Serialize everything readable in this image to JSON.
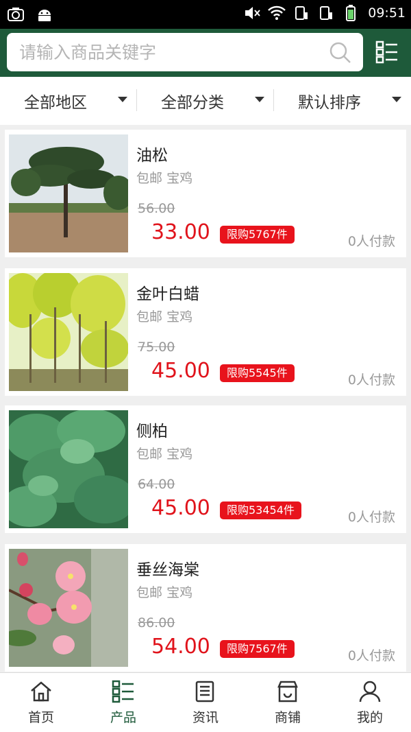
{
  "status_bar": {
    "time": "09:51"
  },
  "search": {
    "placeholder": "请输入商品关键字"
  },
  "filters": [
    {
      "label": "全部地区"
    },
    {
      "label": "全部分类"
    },
    {
      "label": "默认排序"
    }
  ],
  "products": [
    {
      "name": "油松",
      "shipping": "包邮",
      "city": "宝鸡",
      "original_price": "56.00",
      "price": "33.00",
      "limit": "限购5767件",
      "buyers": "0人付款"
    },
    {
      "name": "金叶白蜡",
      "shipping": "包邮",
      "city": "宝鸡",
      "original_price": "75.00",
      "price": "45.00",
      "limit": "限购5545件",
      "buyers": "0人付款"
    },
    {
      "name": "侧柏",
      "shipping": "包邮",
      "city": "宝鸡",
      "original_price": "64.00",
      "price": "45.00",
      "limit": "限购53454件",
      "buyers": "0人付款"
    },
    {
      "name": "垂丝海棠",
      "shipping": "包邮",
      "city": "宝鸡",
      "original_price": "86.00",
      "price": "54.00",
      "limit": "限购7567件",
      "buyers": "0人付款"
    }
  ],
  "bottom_nav": [
    {
      "label": "首页",
      "icon": "home-icon",
      "active": false
    },
    {
      "label": "产品",
      "icon": "product-list-icon",
      "active": true
    },
    {
      "label": "资讯",
      "icon": "news-icon",
      "active": false
    },
    {
      "label": "商铺",
      "icon": "store-icon",
      "active": false
    },
    {
      "label": "我的",
      "icon": "user-icon",
      "active": false
    }
  ],
  "colors": {
    "header_bg": "#1e5a3a",
    "price_red": "#e0131b",
    "active_green": "#1e5a3a"
  }
}
